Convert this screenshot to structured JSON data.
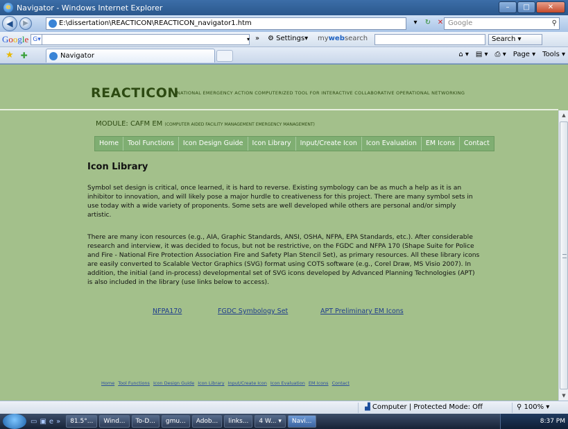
{
  "window": {
    "title": "Navigator - Windows Internet Explorer",
    "buttons": {
      "minimize": "–",
      "maximize": "□",
      "close": "✕"
    }
  },
  "addressbar": {
    "url": "E:\\dissertation\\REACTICON\\REACTICON_navigator1.htm",
    "search_placeholder": "Google"
  },
  "google_toolbar": {
    "logo": [
      "G",
      "o",
      "o",
      "g",
      "l",
      "e"
    ],
    "g_badge": "G▾",
    "settings": "Settings▾",
    "mywebsearch_prefix": "my",
    "mywebsearch_bold": "web",
    "mywebsearch_suffix": "search",
    "search_button": "Search ▾"
  },
  "tabs": {
    "active_tab": "Navigator",
    "commands": [
      "Page ▾",
      "Tools ▾"
    ]
  },
  "page": {
    "brand": "REACTICON",
    "brand_sub": "NATIONAL EMERGENCY ACTION COMPUTERIZED TOOL FOR INTERACTIVE COLLABORATIVE OPERATIONAL NETWORKING",
    "module_label": "MODULE: CAFM EM",
    "module_sub": "(COMPUTER AIDED FACILITY MANAGEMENT EMERGENCY MANAGEMENT)",
    "nav": [
      "Home",
      "Tool Functions",
      "Icon Design Guide",
      "Icon Library",
      "Input/Create Icon",
      "Icon Evaluation",
      "EM Icons",
      "Contact"
    ],
    "heading": "Icon Library",
    "para1": "Symbol set design is critical, once learned, it is hard to reverse. Existing symbology can be as much a help as it is an inhibitor to innovation, and will likely pose a major hurdle to creativeness for this project. There are many symbol sets in use today with a wide variety of proponents. Some sets are well developed while others are personal and/or simply artistic.",
    "para2": "There are many icon resources (e.g., AIA, Graphic Standards, ANSI, OSHA, NFPA, EPA Standards, etc.). After considerable research and interview, it was decided to focus, but not be restrictive, on the FGDC and NFPA 170 (Shape Suite for Police and Fire - National Fire Protection Association Fire and Safety Plan Stencil Set), as primary resources. All these library icons are easily converted to Scalable Vector Graphics (SVG) format using COTS software (e.g., Corel Draw, MS Visio 2007). In addition, the initial (and in-process) developmental set of SVG icons developed by Advanced Planning Technologies (APT) is also included in the library (use links below to access).",
    "library_links": [
      "NFPA170",
      "FGDC Symbology Set",
      "APT Preliminary EM Icons"
    ],
    "footer_nav": [
      "Home",
      "Tool Functions",
      "Icon Design Guide",
      "Icon Library",
      "Input/Create Icon",
      "Icon Evaluation",
      "EM Icons",
      "Contact"
    ]
  },
  "statusbar": {
    "zone": "Computer | Protected Mode: Off",
    "zoom": "100%"
  },
  "taskbar": {
    "items": [
      "81.5°...",
      "Wind...",
      "To-D...",
      "gmu...",
      "Adob...",
      "links...",
      "4 W... ▾",
      "Navi..."
    ],
    "clock": "8:37 PM"
  }
}
